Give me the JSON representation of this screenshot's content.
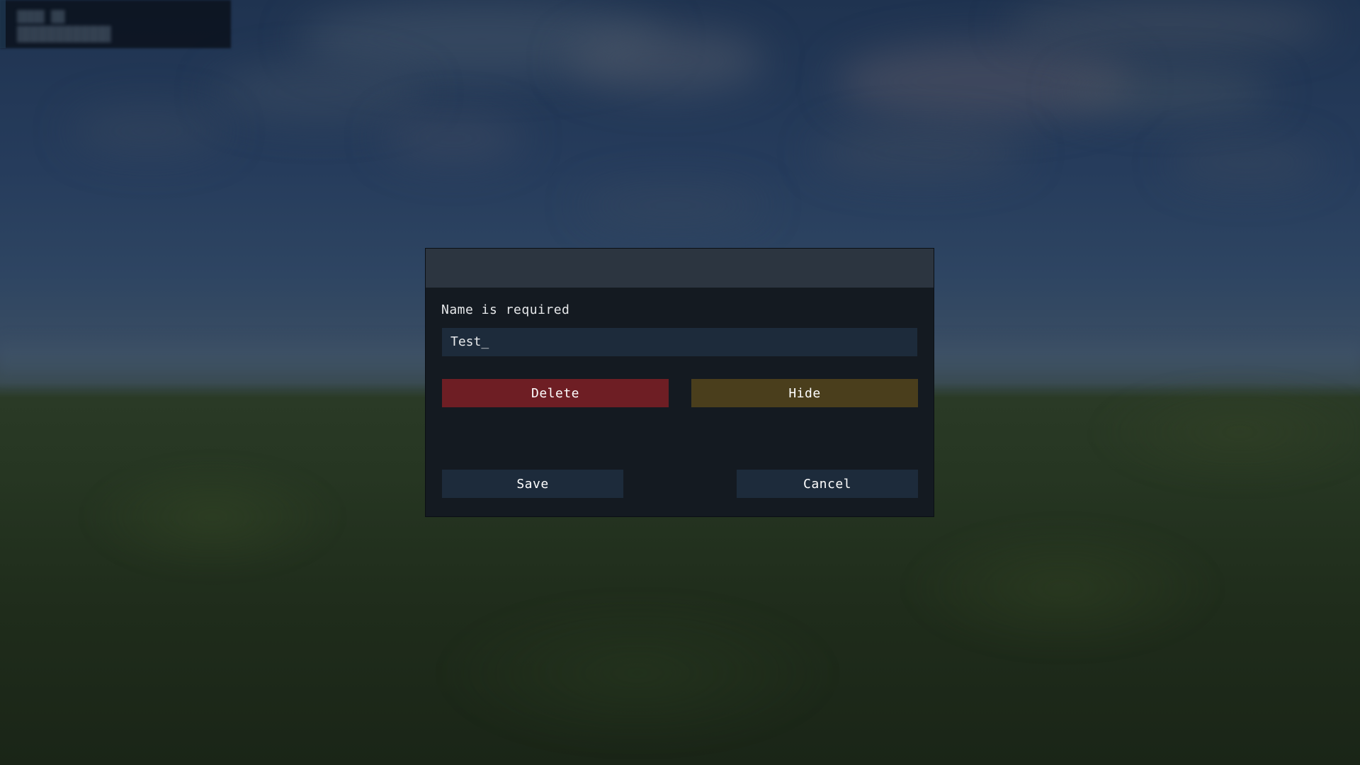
{
  "background_overlay": {
    "line1": "████ ██",
    "line2": "███████████"
  },
  "dialog": {
    "error_message": "Name is required",
    "name_input": {
      "value": "Test_",
      "placeholder": ""
    },
    "buttons": {
      "delete_label": "Delete",
      "hide_label": "Hide",
      "save_label": "Save",
      "cancel_label": "Cancel"
    }
  },
  "colors": {
    "dialog_bg": "#141a21",
    "header_bg": "#2c3540",
    "input_bg": "#1d2b3b",
    "delete_bg": "#6e1e24",
    "hide_bg": "#4a3e1c",
    "text": "#e6e8ea"
  }
}
